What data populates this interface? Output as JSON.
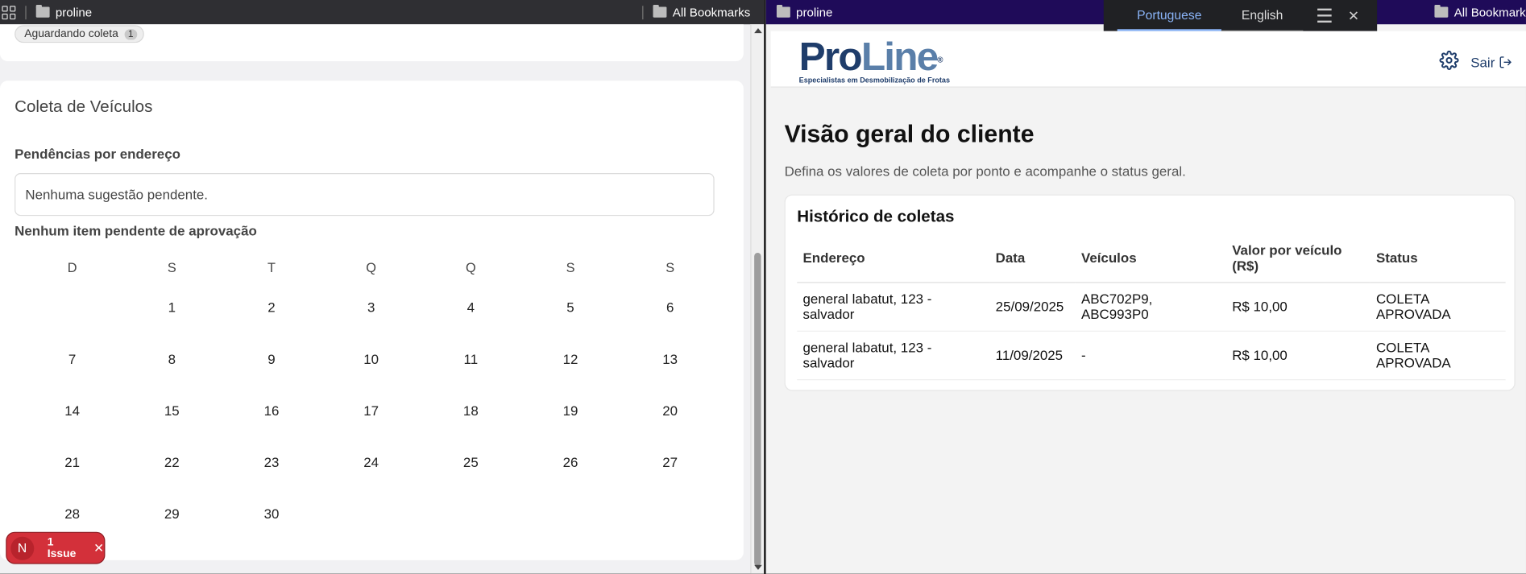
{
  "left_window": {
    "bookmarks": {
      "folder": "proline",
      "all_bookmarks": "All Bookmarks"
    },
    "status_chip": {
      "label": "Aguardando coleta",
      "count": "1"
    },
    "section_title": "Coleta de Veículos",
    "pending_label": "Pendências por endereço",
    "pending_empty": "Nenhuma sugestão pendente.",
    "approval_empty": "Nenhum item pendente de aprovação",
    "calendar": {
      "weekdays": [
        "D",
        "S",
        "T",
        "Q",
        "Q",
        "S",
        "S"
      ],
      "weeks": [
        [
          "",
          "1",
          "2",
          "3",
          "4",
          "5",
          "6"
        ],
        [
          "7",
          "8",
          "9",
          "10",
          "11",
          "12",
          "13"
        ],
        [
          "14",
          "15",
          "16",
          "17",
          "18",
          "19",
          "20"
        ],
        [
          "21",
          "22",
          "23",
          "24",
          "25",
          "26",
          "27"
        ],
        [
          "28",
          "29",
          "30",
          "",
          "",
          "",
          ""
        ]
      ]
    },
    "issue_badge": {
      "logo": "N",
      "label": "1 Issue"
    }
  },
  "right_window": {
    "bookmarks": {
      "folder": "proline",
      "all_bookmarks": "All Bookmarks"
    },
    "translate_bar": {
      "lang_a": "Portuguese",
      "lang_b": "English",
      "active": "Portuguese"
    },
    "brand": {
      "name_a": "Pro",
      "name_b": "Line",
      "registered": "®",
      "tagline": "Especialistas em Desmobilização de Frotas"
    },
    "header": {
      "logout": "Sair"
    },
    "page_title": "Visão geral do cliente",
    "page_subtitle": "Defina os valores de coleta por ponto e acompanhe o status geral.",
    "history": {
      "title": "Histórico de coletas",
      "columns": [
        "Endereço",
        "Data",
        "Veículos",
        "Valor por veículo (R$)",
        "Status"
      ],
      "rows": [
        {
          "address": "general labatut, 123 - salvador",
          "date": "25/09/2025",
          "vehicles": "ABC702P9, ABC993P0",
          "value": "R$ 10,00",
          "status": "COLETA APROVADA"
        },
        {
          "address": "general labatut, 123 - salvador",
          "date": "11/09/2025",
          "vehicles": "-",
          "value": "R$ 10,00",
          "status": "COLETA APROVADA"
        }
      ]
    }
  },
  "colors": {
    "brand_navy": "#1f3d6b",
    "issue_red": "#d3303a",
    "bookmark_bar_right": "#1f0b59",
    "translate_active": "#8ab4f8"
  },
  "icons": [
    "apps-grid-icon",
    "folder-icon",
    "menu-icon",
    "close-icon",
    "gear-icon",
    "logout-icon",
    "scroll-up-arrow-icon",
    "scroll-down-arrow-icon"
  ]
}
